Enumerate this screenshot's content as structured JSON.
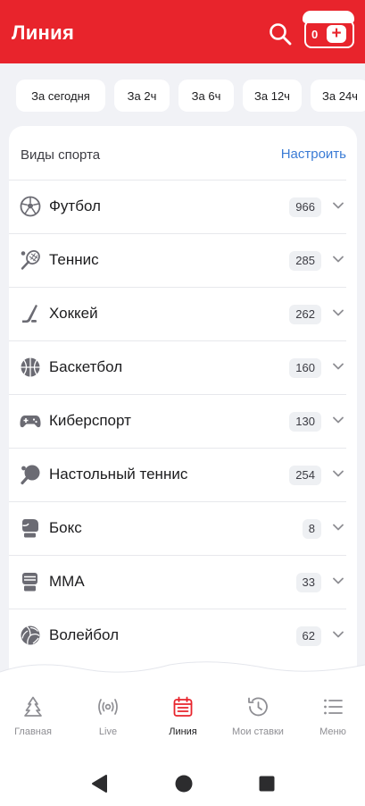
{
  "header": {
    "title": "Линия",
    "coupon_count": "0",
    "coupon_plus": "+"
  },
  "filters": [
    "За сегодня",
    "За 2ч",
    "За 6ч",
    "За 12ч",
    "За 24ч"
  ],
  "sports_section": {
    "title": "Виды спорта",
    "action": "Настроить"
  },
  "sports": [
    {
      "name": "Футбол",
      "count": "966",
      "icon": "soccer-ball-icon"
    },
    {
      "name": "Теннис",
      "count": "285",
      "icon": "tennis-racket-icon"
    },
    {
      "name": "Хоккей",
      "count": "262",
      "icon": "hockey-stick-icon"
    },
    {
      "name": "Баскетбол",
      "count": "160",
      "icon": "basketball-icon"
    },
    {
      "name": "Киберспорт",
      "count": "130",
      "icon": "gamepad-icon"
    },
    {
      "name": "Настольный теннис",
      "count": "254",
      "icon": "table-tennis-icon"
    },
    {
      "name": "Бокс",
      "count": "8",
      "icon": "boxing-glove-icon"
    },
    {
      "name": "ММА",
      "count": "33",
      "icon": "mma-glove-icon"
    },
    {
      "name": "Волейбол",
      "count": "62",
      "icon": "volleyball-icon"
    }
  ],
  "bottom_nav": [
    {
      "label": "Главная",
      "icon": "home-tree-icon"
    },
    {
      "label": "Live",
      "icon": "live-broadcast-icon"
    },
    {
      "label": "Линия",
      "icon": "calendar-icon",
      "active": true
    },
    {
      "label": "Мои ставки",
      "icon": "history-icon"
    },
    {
      "label": "Меню",
      "icon": "menu-list-icon"
    }
  ],
  "colors": {
    "brand_red": "#e8242c",
    "link_blue": "#3a7bd5",
    "background": "#f1f2f6"
  }
}
